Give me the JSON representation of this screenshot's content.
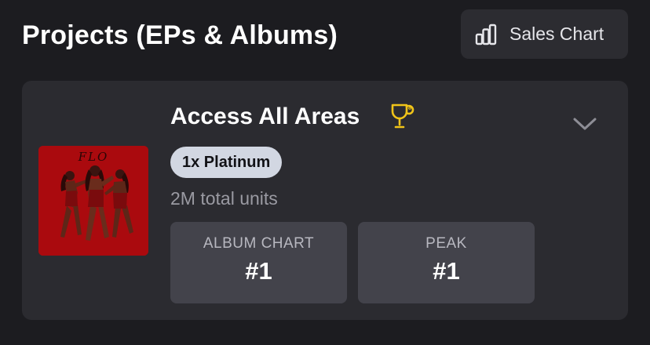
{
  "header": {
    "title": "Projects (EPs & Albums)",
    "sales_chart_button": {
      "label": "Sales Chart",
      "icon": "bar-chart-icon"
    }
  },
  "project": {
    "title": "Access All Areas",
    "cover_logo_text": "FLO",
    "certification_icon": "trophy-icon",
    "certification_color": "#f0c419",
    "certification": "1x Platinum",
    "total_units": "2M total units",
    "stats": [
      {
        "label": "ALBUM CHART",
        "value": "#1"
      },
      {
        "label": "PEAK",
        "value": "#1"
      }
    ]
  }
}
